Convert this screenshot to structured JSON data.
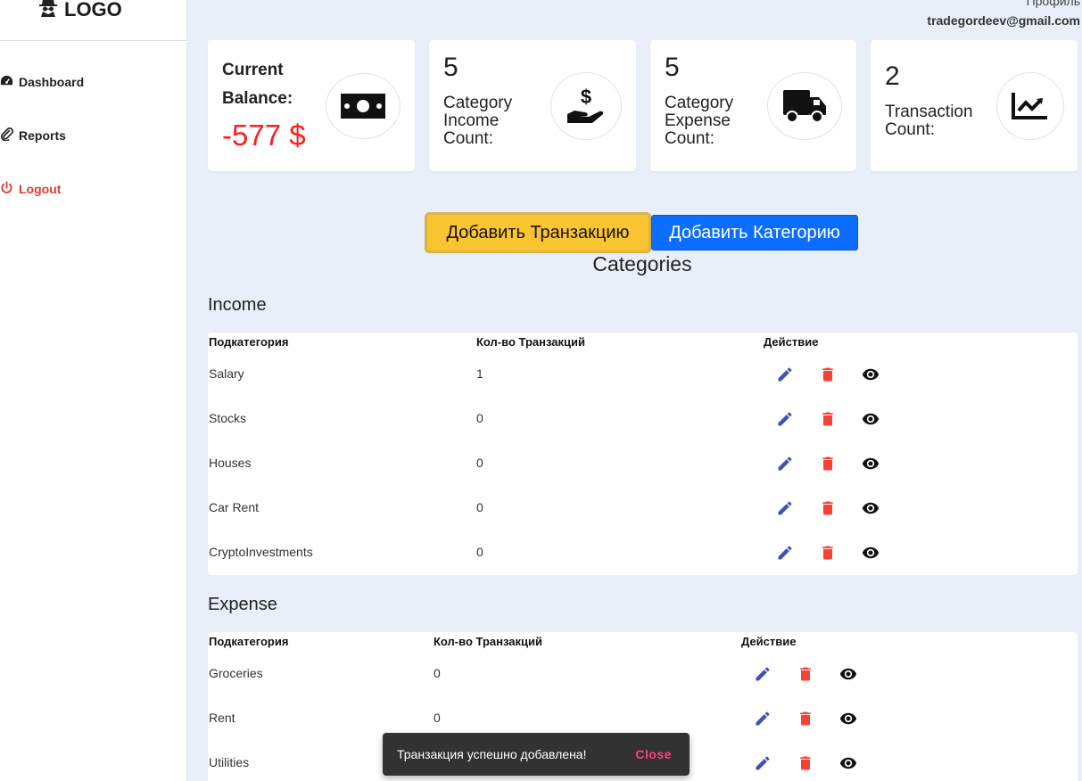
{
  "sidebar": {
    "logo_text": "LOGO",
    "logo_icon": "detective-icon",
    "items": [
      {
        "label": "Dashboard",
        "icon": "tachometer-icon"
      },
      {
        "label": "Reports",
        "icon": "paperclip-icon"
      },
      {
        "label": "Logout",
        "icon": "power-icon",
        "color": "#e53935"
      }
    ]
  },
  "header": {
    "profile_label": "Профиль",
    "email": "tradegordeev@gmail.com"
  },
  "stats": {
    "balance": {
      "label": "Current Balance:",
      "value": "-577 $",
      "icon": "money-bill-icon",
      "value_color": "#ff1f1f"
    },
    "income_categories": {
      "value": "5",
      "label": "Category Income Count:",
      "icon": "hand-holding-dollar-icon"
    },
    "expense_categories": {
      "value": "5",
      "label": "Category Expense Count:",
      "icon": "truck-icon"
    },
    "transactions": {
      "value": "2",
      "label": "Transaction Count:",
      "icon": "chart-line-icon"
    }
  },
  "actions": {
    "add_transaction": "Добавить Транзакцию",
    "add_category": "Добавить Категорию",
    "add_transaction_color": "#fbc531",
    "add_category_color": "#0d6efd"
  },
  "categories_title": "Categories",
  "income": {
    "title": "Income",
    "headers": [
      "Подкатегория",
      "Кол-во Транзакций",
      "Действие"
    ],
    "rows": [
      {
        "name": "Salary",
        "count": "1"
      },
      {
        "name": "Stocks",
        "count": "0"
      },
      {
        "name": "Houses",
        "count": "0"
      },
      {
        "name": "Car Rent",
        "count": "0"
      },
      {
        "name": "CryptoInvestments",
        "count": "0"
      }
    ]
  },
  "expense": {
    "title": "Expense",
    "headers": [
      "Подкатегория",
      "Кол-во Транзакций",
      "Действие"
    ],
    "rows": [
      {
        "name": "Groceries",
        "count": "0"
      },
      {
        "name": "Rent",
        "count": "0"
      },
      {
        "name": "Utilities",
        "count": ""
      }
    ]
  },
  "action_icons": {
    "edit": "pencil-icon",
    "delete": "trash-icon",
    "view": "eye-icon",
    "edit_color": "#3f51b5",
    "delete_color": "#f44336",
    "view_color": "#111111"
  },
  "snackbar": {
    "message": "Транзакция успешно добавлена!",
    "action": "Close",
    "action_color": "#ff4081"
  }
}
